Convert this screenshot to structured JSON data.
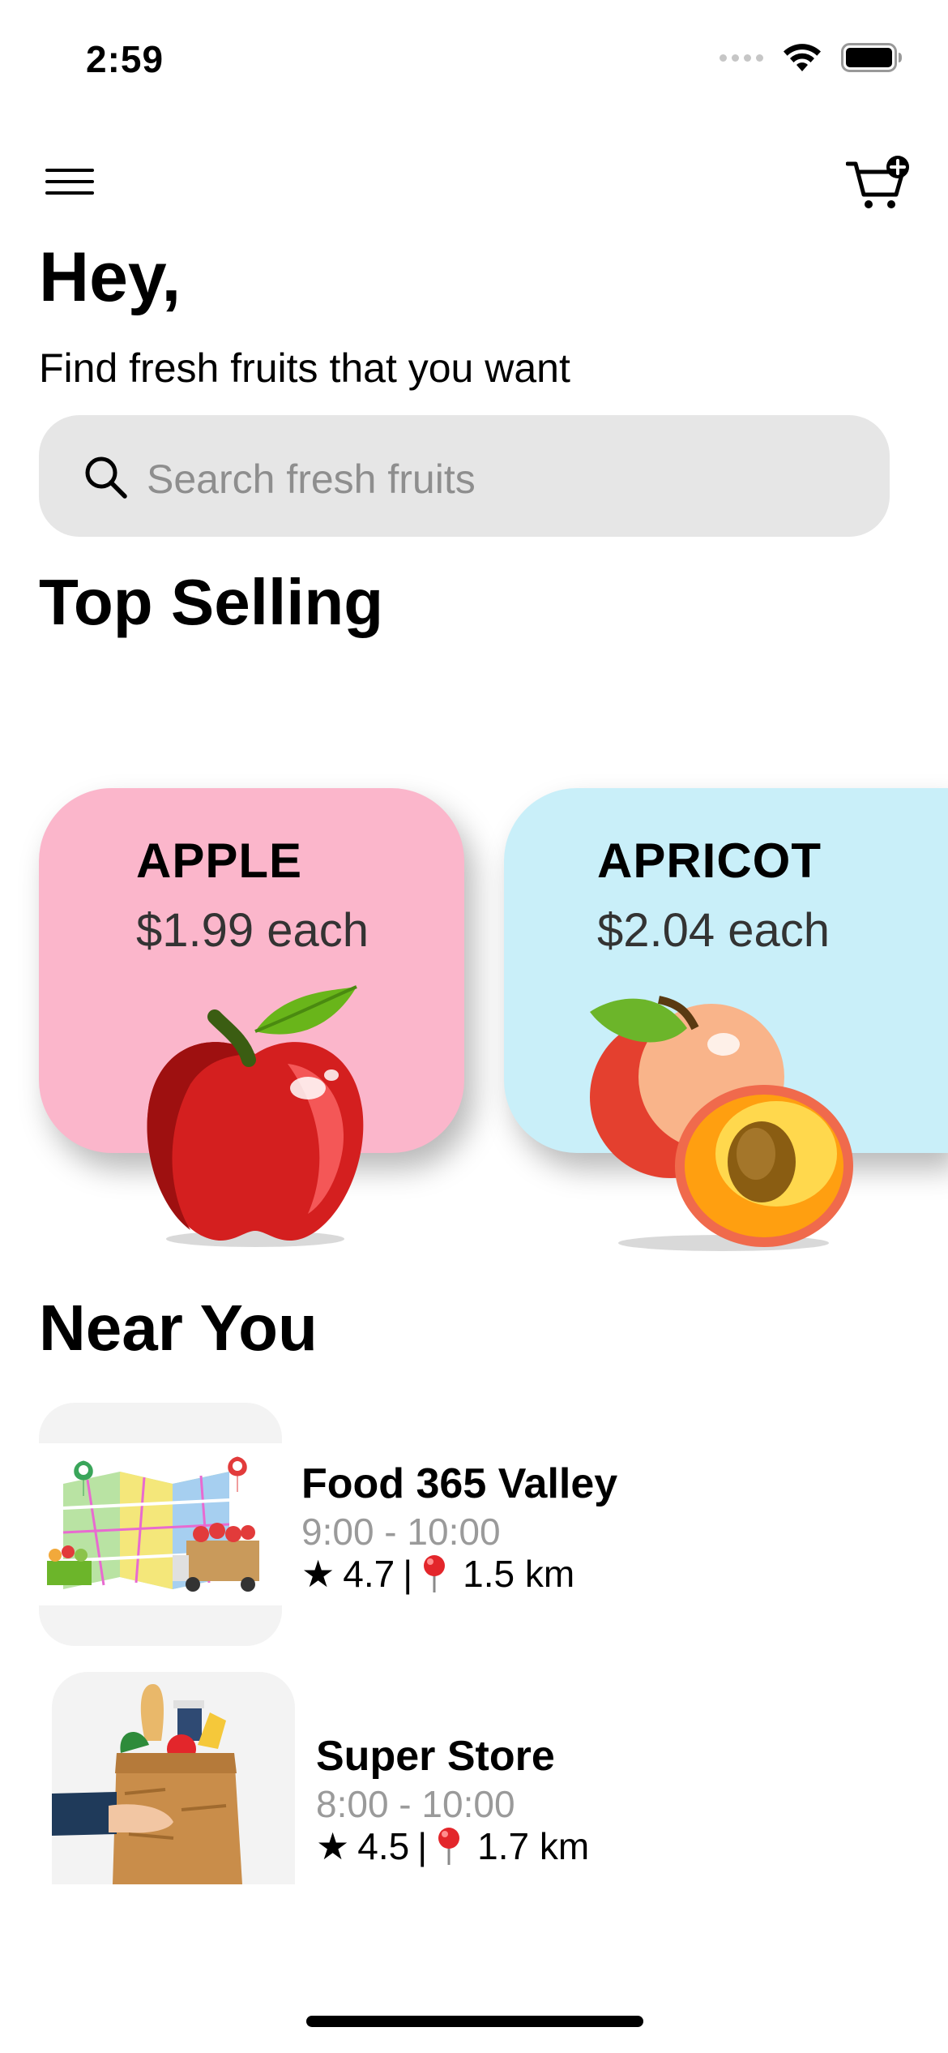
{
  "status_bar": {
    "time": "2:59"
  },
  "header": {
    "menu_icon": "hamburger-menu-icon",
    "cart_icon": "cart-add-icon"
  },
  "greeting": {
    "title": "Hey,",
    "subtitle": "Find fresh fruits that you want"
  },
  "search": {
    "placeholder": "Search fresh fruits",
    "value": ""
  },
  "top_selling": {
    "title": "Top Selling",
    "items": [
      {
        "name": "APPLE",
        "price": "$1.99 each",
        "color": "#fbb6cb",
        "image": "apple-image"
      },
      {
        "name": "APRICOT",
        "price": "$2.04 each",
        "color": "#c9eff9",
        "image": "apricot-image"
      }
    ]
  },
  "near_you": {
    "title": "Near You",
    "stores": [
      {
        "name": "Food 365 Valley",
        "hours": "9:00 - 10:00",
        "rating": "4.7",
        "distance": "1.5 km",
        "image": "map-delivery-image"
      },
      {
        "name": "Super Store",
        "hours": "8:00 - 10:00",
        "rating": "4.5",
        "distance": "1.7 km",
        "image": "grocery-bag-image"
      }
    ],
    "separator": "|"
  },
  "colors": {
    "search_bg": "#e6e6e6",
    "muted_text": "#9a9a9a",
    "thumb_bg": "#f3f3f3"
  }
}
